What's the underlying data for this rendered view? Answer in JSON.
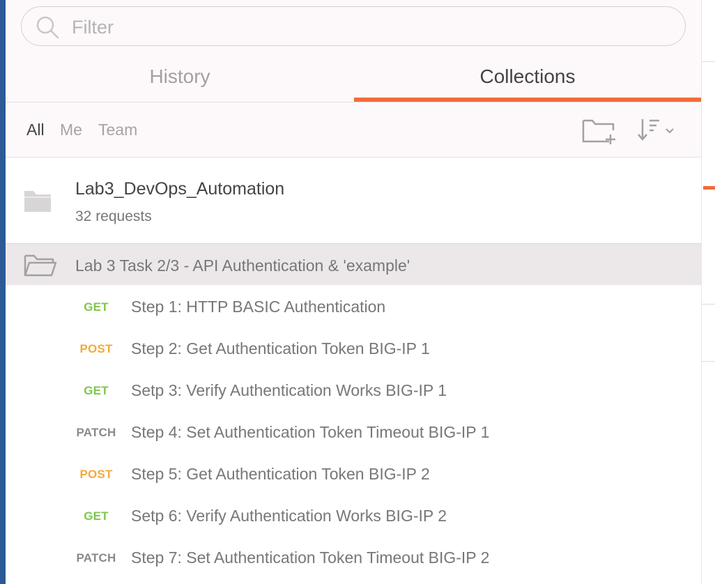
{
  "search": {
    "placeholder": "Filter",
    "value": ""
  },
  "tabs": [
    {
      "label": "History",
      "active": false
    },
    {
      "label": "Collections",
      "active": true
    }
  ],
  "filters": [
    {
      "label": "All",
      "active": true
    },
    {
      "label": "Me",
      "active": false
    },
    {
      "label": "Team",
      "active": false
    }
  ],
  "toolbar_icons": {
    "new_collection": "new-folder-icon",
    "sort": "sort-icon"
  },
  "collection": {
    "name": "Lab3_DevOps_Automation",
    "count": "32 requests"
  },
  "folder": {
    "name": "Lab 3 Task 2/3 - API Authentication & 'example'"
  },
  "requests": [
    {
      "method": "GET",
      "name": "Step 1: HTTP BASIC Authentication"
    },
    {
      "method": "POST",
      "name": "Step 2: Get Authentication Token BIG-IP 1"
    },
    {
      "method": "GET",
      "name": "Setp 3: Verify Authentication Works BIG-IP 1"
    },
    {
      "method": "PATCH",
      "name": "Step 4: Set Authentication Token Timeout BIG-IP 1"
    },
    {
      "method": "POST",
      "name": "Step 5: Get Authentication Token BIG-IP 2"
    },
    {
      "method": "GET",
      "name": "Setp 6: Verify Authentication Works BIG-IP 2"
    },
    {
      "method": "PATCH",
      "name": "Step 7: Set Authentication Token Timeout BIG-IP 2"
    }
  ],
  "colors": {
    "accent": "#f26b3a",
    "get": "#7ec74a",
    "post": "#f4a93a",
    "patch": "#8a8a8a"
  }
}
